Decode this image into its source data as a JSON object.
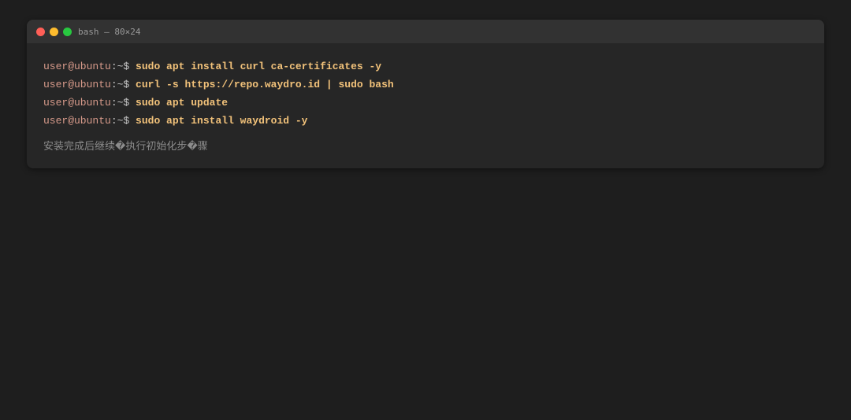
{
  "window": {
    "title": "bash — 80×24",
    "controls": {
      "close_color": "#ff5f57",
      "minimize_color": "#febc2e",
      "zoom_color": "#28c840"
    }
  },
  "prompt": {
    "user_host": "user@ubuntu",
    "path_suffix": ":~$ "
  },
  "lines": [
    {
      "command": "sudo apt install curl ca-certificates -y"
    },
    {
      "command": "curl -s https://repo.waydro.id | sudo bash"
    },
    {
      "command": "sudo apt update"
    },
    {
      "command": "sudo apt install waydroid -y"
    }
  ],
  "note": "安装完成后继续�执行初始化步�骤",
  "colors": {
    "background": "#1e1e1e",
    "window": "#262626",
    "title_bar": "#323232",
    "prompt": "#d79a8a",
    "command": "#f2c27a",
    "note": "#8c8c8c"
  }
}
